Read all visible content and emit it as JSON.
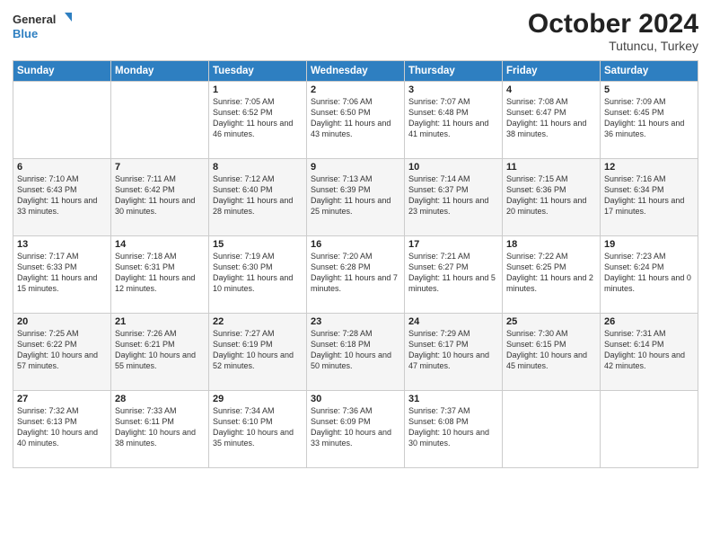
{
  "header": {
    "logo_line1": "General",
    "logo_line2": "Blue",
    "title": "October 2024",
    "location": "Tutuncu, Turkey"
  },
  "weekdays": [
    "Sunday",
    "Monday",
    "Tuesday",
    "Wednesday",
    "Thursday",
    "Friday",
    "Saturday"
  ],
  "weeks": [
    [
      {
        "day": "",
        "info": ""
      },
      {
        "day": "",
        "info": ""
      },
      {
        "day": "1",
        "info": "Sunrise: 7:05 AM\nSunset: 6:52 PM\nDaylight: 11 hours and 46 minutes."
      },
      {
        "day": "2",
        "info": "Sunrise: 7:06 AM\nSunset: 6:50 PM\nDaylight: 11 hours and 43 minutes."
      },
      {
        "day": "3",
        "info": "Sunrise: 7:07 AM\nSunset: 6:48 PM\nDaylight: 11 hours and 41 minutes."
      },
      {
        "day": "4",
        "info": "Sunrise: 7:08 AM\nSunset: 6:47 PM\nDaylight: 11 hours and 38 minutes."
      },
      {
        "day": "5",
        "info": "Sunrise: 7:09 AM\nSunset: 6:45 PM\nDaylight: 11 hours and 36 minutes."
      }
    ],
    [
      {
        "day": "6",
        "info": "Sunrise: 7:10 AM\nSunset: 6:43 PM\nDaylight: 11 hours and 33 minutes."
      },
      {
        "day": "7",
        "info": "Sunrise: 7:11 AM\nSunset: 6:42 PM\nDaylight: 11 hours and 30 minutes."
      },
      {
        "day": "8",
        "info": "Sunrise: 7:12 AM\nSunset: 6:40 PM\nDaylight: 11 hours and 28 minutes."
      },
      {
        "day": "9",
        "info": "Sunrise: 7:13 AM\nSunset: 6:39 PM\nDaylight: 11 hours and 25 minutes."
      },
      {
        "day": "10",
        "info": "Sunrise: 7:14 AM\nSunset: 6:37 PM\nDaylight: 11 hours and 23 minutes."
      },
      {
        "day": "11",
        "info": "Sunrise: 7:15 AM\nSunset: 6:36 PM\nDaylight: 11 hours and 20 minutes."
      },
      {
        "day": "12",
        "info": "Sunrise: 7:16 AM\nSunset: 6:34 PM\nDaylight: 11 hours and 17 minutes."
      }
    ],
    [
      {
        "day": "13",
        "info": "Sunrise: 7:17 AM\nSunset: 6:33 PM\nDaylight: 11 hours and 15 minutes."
      },
      {
        "day": "14",
        "info": "Sunrise: 7:18 AM\nSunset: 6:31 PM\nDaylight: 11 hours and 12 minutes."
      },
      {
        "day": "15",
        "info": "Sunrise: 7:19 AM\nSunset: 6:30 PM\nDaylight: 11 hours and 10 minutes."
      },
      {
        "day": "16",
        "info": "Sunrise: 7:20 AM\nSunset: 6:28 PM\nDaylight: 11 hours and 7 minutes."
      },
      {
        "day": "17",
        "info": "Sunrise: 7:21 AM\nSunset: 6:27 PM\nDaylight: 11 hours and 5 minutes."
      },
      {
        "day": "18",
        "info": "Sunrise: 7:22 AM\nSunset: 6:25 PM\nDaylight: 11 hours and 2 minutes."
      },
      {
        "day": "19",
        "info": "Sunrise: 7:23 AM\nSunset: 6:24 PM\nDaylight: 11 hours and 0 minutes."
      }
    ],
    [
      {
        "day": "20",
        "info": "Sunrise: 7:25 AM\nSunset: 6:22 PM\nDaylight: 10 hours and 57 minutes."
      },
      {
        "day": "21",
        "info": "Sunrise: 7:26 AM\nSunset: 6:21 PM\nDaylight: 10 hours and 55 minutes."
      },
      {
        "day": "22",
        "info": "Sunrise: 7:27 AM\nSunset: 6:19 PM\nDaylight: 10 hours and 52 minutes."
      },
      {
        "day": "23",
        "info": "Sunrise: 7:28 AM\nSunset: 6:18 PM\nDaylight: 10 hours and 50 minutes."
      },
      {
        "day": "24",
        "info": "Sunrise: 7:29 AM\nSunset: 6:17 PM\nDaylight: 10 hours and 47 minutes."
      },
      {
        "day": "25",
        "info": "Sunrise: 7:30 AM\nSunset: 6:15 PM\nDaylight: 10 hours and 45 minutes."
      },
      {
        "day": "26",
        "info": "Sunrise: 7:31 AM\nSunset: 6:14 PM\nDaylight: 10 hours and 42 minutes."
      }
    ],
    [
      {
        "day": "27",
        "info": "Sunrise: 7:32 AM\nSunset: 6:13 PM\nDaylight: 10 hours and 40 minutes."
      },
      {
        "day": "28",
        "info": "Sunrise: 7:33 AM\nSunset: 6:11 PM\nDaylight: 10 hours and 38 minutes."
      },
      {
        "day": "29",
        "info": "Sunrise: 7:34 AM\nSunset: 6:10 PM\nDaylight: 10 hours and 35 minutes."
      },
      {
        "day": "30",
        "info": "Sunrise: 7:36 AM\nSunset: 6:09 PM\nDaylight: 10 hours and 33 minutes."
      },
      {
        "day": "31",
        "info": "Sunrise: 7:37 AM\nSunset: 6:08 PM\nDaylight: 10 hours and 30 minutes."
      },
      {
        "day": "",
        "info": ""
      },
      {
        "day": "",
        "info": ""
      }
    ]
  ]
}
